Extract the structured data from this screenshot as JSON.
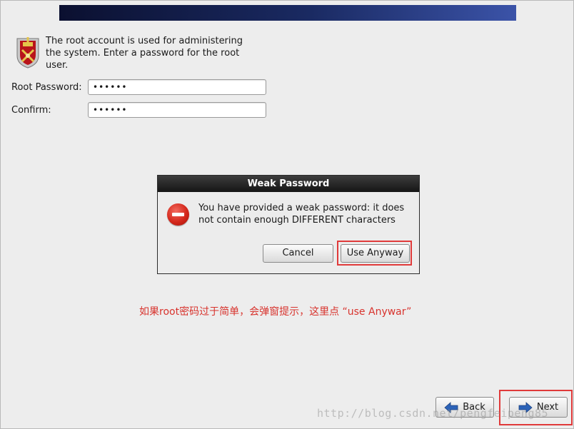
{
  "intro": {
    "line1": "The root account is used for administering",
    "line2": "the system.  Enter a password for the root",
    "line3": "user."
  },
  "fields": {
    "root_password_label": "Root Password:",
    "root_password_value": "••••••",
    "confirm_label": "Confirm:",
    "confirm_value": "••••••"
  },
  "dialog": {
    "title": "Weak Password",
    "message_line1": "You have provided a weak password: it does",
    "message_line2": "not contain enough DIFFERENT characters",
    "cancel_label": "Cancel",
    "use_anyway_label": "Use Anyway",
    "icon": "error-icon"
  },
  "annotation": "如果root密码过于简单，会弹窗提示，这里点 “use Anywar”",
  "nav": {
    "back_label": "Back",
    "next_label": "Next"
  },
  "watermark": "http://blog.csdn.net/pengfeipeng85",
  "colors": {
    "highlight": "#e03a3a",
    "annotation": "#d8332d",
    "banner": "#1a2a62"
  }
}
